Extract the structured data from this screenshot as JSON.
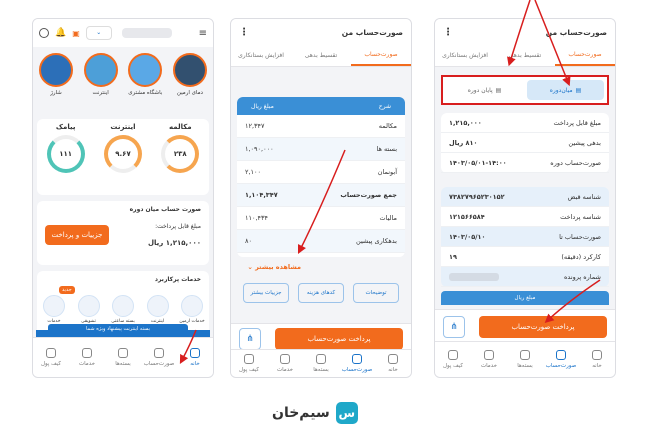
{
  "p1": {
    "stories": [
      "دمای ارمین",
      "باشگاه مشتری",
      "اینترنت",
      "شارژ"
    ],
    "usage_titles": [
      "مکالمه",
      "اینترنت",
      "پیامک"
    ],
    "usage_values": [
      "۲۳۸",
      "۹.۶۷",
      "۱۱۱"
    ],
    "bill_title": "صورت حساب میان دوره",
    "bill_label": "مبلغ قابل پرداخت:",
    "bill_amount": "۱,۲۱۵,۰۰۰ ریال",
    "pay_button": "جزییات و پرداخت",
    "services_title": "خدمات پرکاربرد",
    "new_badge": "جدید",
    "services": [
      "خدمات ارمین",
      "تشویقی",
      "بسته ساعتی",
      "اینترنت",
      "ساز",
      "خدمات"
    ],
    "banner": "بسته اینترنت پیشنهاد ویژه شما",
    "nav": [
      "خانه",
      "صورت‌حساب",
      "بسته‌ها",
      "خدمات",
      "کیف پول"
    ]
  },
  "p2": {
    "header": "صورت‌حساب من",
    "tabs": [
      "صورت‌حساب",
      "تقسیط بدهی",
      "افزایش بستانکاری"
    ],
    "table_head": [
      "شرح",
      "مبلغ ریال"
    ],
    "rows": [
      [
        "مکالمه",
        "۱۲,۳۴۷"
      ],
      [
        "بسته ها",
        "۱,۰۹۰,۰۰۰"
      ],
      [
        "آبونمان",
        "۲,۱۰۰"
      ],
      [
        "جمع صورت‌حساب",
        "۱,۱۰۴,۳۴۷"
      ],
      [
        "مالیات",
        "۱۱۰,۴۳۴"
      ],
      [
        "بدهکاری پیشین",
        "۸۰"
      ]
    ],
    "more": "مشاهده بیشتر",
    "actions": [
      "توضیحات",
      "کدهای هزینه",
      "جزییات بیشتر"
    ],
    "pay_button": "پرداخت صورت‌حساب",
    "nav": [
      "خانه",
      "صورت‌حساب",
      "بسته‌ها",
      "خدمات",
      "کیف پول"
    ]
  },
  "p3": {
    "header": "صورت‌حساب من",
    "tabs": [
      "صورت‌حساب",
      "تقسیط بدهی",
      "افزایش بستانکاری"
    ],
    "sub_tabs": [
      "میان‌دوره",
      "پایان دوره"
    ],
    "info": [
      [
        "مبلغ قابل پرداخت",
        "۱,۲۱۵,۰۰۰"
      ],
      [
        "بدهی پیشین",
        "۸۱۰ ریال"
      ],
      [
        "صورت‌حساب دوره",
        "۱۴۰۳/۰۵/۰۱-۱۴:۰۰"
      ]
    ],
    "info2": [
      [
        "شناسه قبض",
        "۷۳۸۲۷۹۶۵۲۳۰۱۵۲"
      ],
      [
        "شناسه پرداخت",
        "۱۲۱۵۶۶۵۸۴"
      ],
      [
        "صورت‌حساب تا",
        "۱۴۰۳/۰۵/۱۰"
      ],
      [
        "کارکرد (دقیقه)",
        "۱۹"
      ],
      [
        "شماره پرونده",
        ""
      ]
    ],
    "amount_head": "مبلغ ریال",
    "pay_button": "پرداخت صورت‌حساب",
    "nav": [
      "خانه",
      "صورت‌حساب",
      "بسته‌ها",
      "خدمات",
      "کیف پول"
    ]
  },
  "brand": "سیم‌خان",
  "colors": {
    "orange": "#f26b1d",
    "blue": "#1a73c9",
    "red": "#d81e1e"
  }
}
